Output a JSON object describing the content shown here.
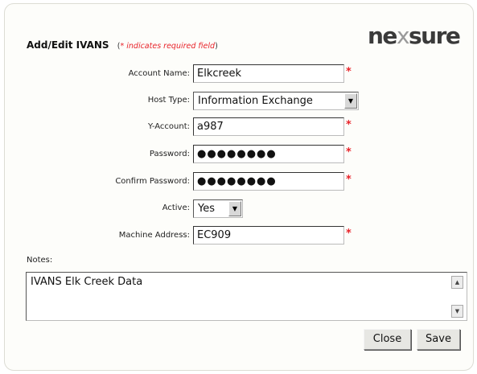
{
  "header": {
    "title": "Add/Edit IVANS",
    "required_note_open": "(",
    "required_note_star": "*",
    "required_note_text": " indicates required field",
    "required_note_close": ")"
  },
  "logo": {
    "part1": "ne",
    "part2": "x",
    "part3": "sure"
  },
  "form": {
    "account_name": {
      "label": "Account Name:",
      "value": "Elkcreek",
      "required": "*"
    },
    "host_type": {
      "label": "Host Type:",
      "value": "Information Exchange"
    },
    "y_account": {
      "label": "Y-Account:",
      "value": "a987",
      "required": "*"
    },
    "password": {
      "label": "Password:",
      "value": "●●●●●●●●",
      "required": "*"
    },
    "confirm_password": {
      "label": "Confirm Password:",
      "value": "●●●●●●●●",
      "required": "*"
    },
    "active": {
      "label": "Active:",
      "value": "Yes"
    },
    "machine_address": {
      "label": "Machine Address:",
      "value": "EC909",
      "required": "*"
    }
  },
  "notes": {
    "label": "Notes:",
    "value": "IVANS Elk Creek Data"
  },
  "buttons": {
    "close": "Close",
    "save": "Save"
  },
  "colors": {
    "required": "#e8232a"
  },
  "icons": {
    "dropdown": "chevron-down-icon",
    "scroll_up": "scroll-up-icon",
    "scroll_down": "scroll-down-icon"
  }
}
